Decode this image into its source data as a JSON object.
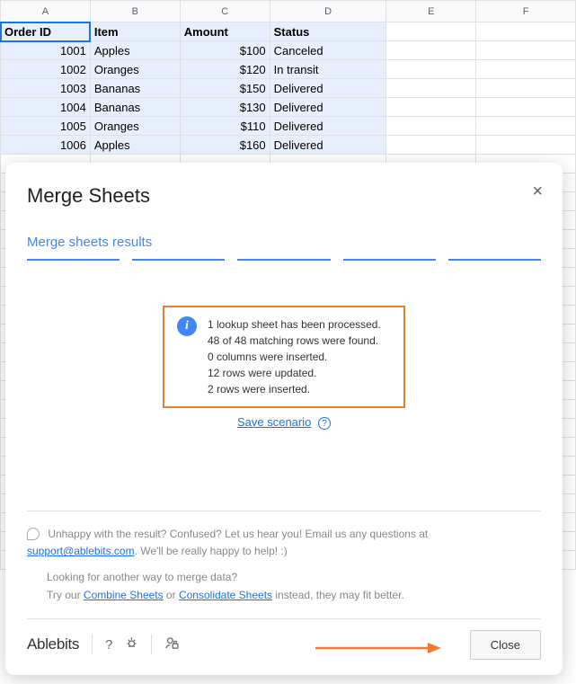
{
  "sheet": {
    "columns": [
      "A",
      "B",
      "C",
      "D",
      "E",
      "F"
    ],
    "headers": [
      "Order ID",
      "Item",
      "Amount",
      "Status"
    ],
    "rows": [
      {
        "id": "1001",
        "item": "Apples",
        "amount": "$100",
        "status": "Canceled"
      },
      {
        "id": "1002",
        "item": "Oranges",
        "amount": "$120",
        "status": "In transit"
      },
      {
        "id": "1003",
        "item": "Bananas",
        "amount": "$150",
        "status": "Delivered"
      },
      {
        "id": "1004",
        "item": "Bananas",
        "amount": "$130",
        "status": "Delivered"
      },
      {
        "id": "1005",
        "item": "Oranges",
        "amount": "$110",
        "status": "Delivered"
      },
      {
        "id": "1006",
        "item": "Apples",
        "amount": "$160",
        "status": "Delivered"
      }
    ]
  },
  "dialog": {
    "title": "Merge Sheets",
    "subtitle": "Merge sheets results",
    "result_lines": [
      "1 lookup sheet has been processed.",
      "48 of 48 matching rows were found.",
      "0 columns were inserted.",
      "12 rows were updated.",
      "2 rows were inserted."
    ],
    "save_scenario": "Save scenario",
    "footer1_prefix": "Unhappy with the result? Confused? Let us hear you! Email us any questions at ",
    "footer1_link": "support@ablebits.com",
    "footer1_suffix": ". We'll be really happy to help! :)",
    "footer2_line1": "Looking for another way to merge data?",
    "footer2_prefix": "Try our ",
    "footer2_link1": "Combine Sheets",
    "footer2_mid": " or ",
    "footer2_link2": "Consolidate Sheets",
    "footer2_suffix": " instead, they may fit better.",
    "brand": "Ablebits",
    "close": "Close"
  }
}
